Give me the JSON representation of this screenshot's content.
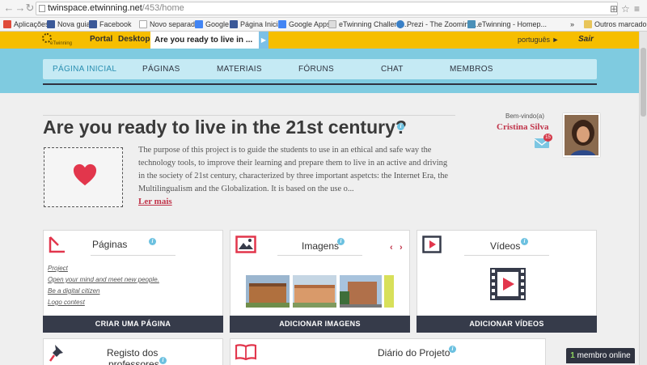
{
  "browser": {
    "url_host": "twinspace.etwinning.net",
    "url_path": "/453/home",
    "bookmarks": [
      {
        "label": "Aplicações",
        "color": "#e04b3a"
      },
      {
        "label": "Nova guia",
        "color": "#3b5998"
      },
      {
        "label": "Facebook",
        "color": "#3b5998"
      },
      {
        "label": "Novo separador",
        "color": "#ffffff"
      },
      {
        "label": "Google",
        "color": "#4285f4"
      },
      {
        "label": "Página Inicial",
        "color": "#3b5998"
      },
      {
        "label": "Google Apps",
        "color": "#4285f4"
      },
      {
        "label": "eTwinning Challeng...",
        "color": "#dddddd"
      },
      {
        "label": "Prezi - The Zooming...",
        "color": "#3a80c7"
      },
      {
        "label": "eTwinning - Homep...",
        "color": "#4a90b8"
      }
    ],
    "bookmarks_more": "»",
    "other_bookmarks": "Outros marcadores"
  },
  "topbar": {
    "logo_text": "eTwinning",
    "portal": "Portal",
    "desktop": "Desktop",
    "project_tab": "Are you ready to live in ...",
    "language": "português ►",
    "logout": "Sair"
  },
  "nav": {
    "items": [
      "PÁGINA INICIAL",
      "PÁGINAS",
      "MATERIAIS",
      "FÓRUNS",
      "CHAT",
      "MEMBROS"
    ]
  },
  "project": {
    "title": "Are you ready to live in the 21st century?",
    "description": "The purpose of this project is to guide the students to use in an ethical and safe way the technology tools, to improve their learning and prepare them to live in an active and driving in the society of 21st century, characterized by three important aspetcts: the Internet Era, the Multilingualism and the Globalization. It is based on the use o...",
    "read_more": "Ler mais"
  },
  "user": {
    "welcome": "Bem-vindo(a)",
    "name": "Cristina Silva",
    "messages": "15"
  },
  "cards": {
    "pages": {
      "title": "Páginas",
      "links": [
        "Project",
        "Open your mind and meet new people.",
        "Be a digital citizen",
        "Logo contest"
      ],
      "button": "CRIAR UMA PÁGINA"
    },
    "images": {
      "title": "Imagens",
      "button": "ADICIONAR IMAGENS"
    },
    "videos": {
      "title": "Vídeos",
      "button": "ADICIONAR VÍDEOS"
    },
    "register": {
      "title_line1": "Registo dos",
      "title_line2": "professores"
    },
    "diary": {
      "title": "Diário do Projeto"
    }
  },
  "online": {
    "count": "1",
    "label": " membro online"
  }
}
